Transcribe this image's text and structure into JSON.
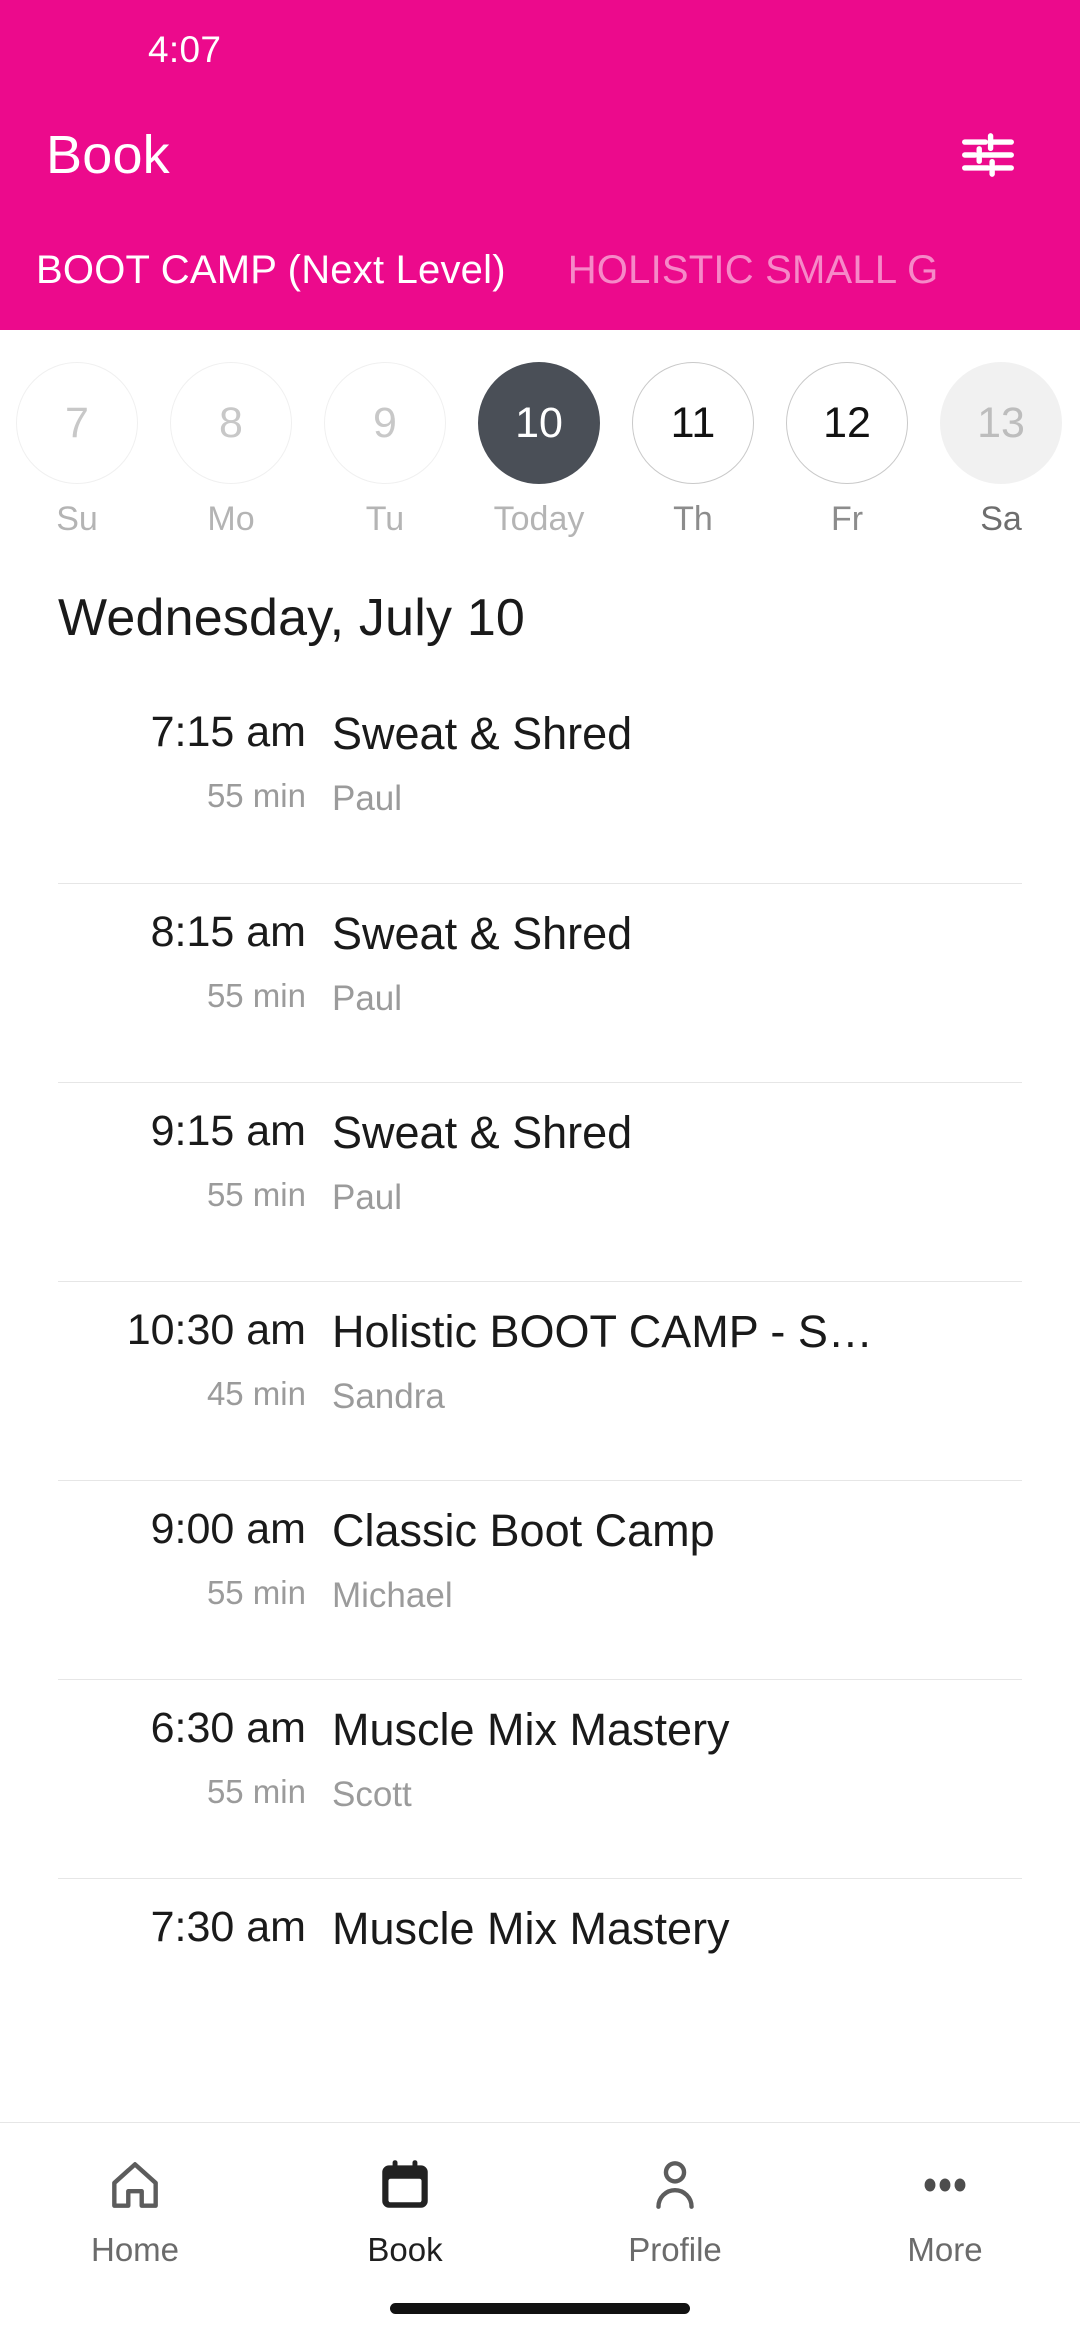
{
  "theme": {
    "brand_pink": "#ec0a8c",
    "selected_day": "#4a4f57",
    "text_primary": "#1a1a1a",
    "text_secondary": "#9b9b9b"
  },
  "status_bar": {
    "time": "4:07"
  },
  "header": {
    "title": "Book",
    "filter_icon": "tune-icon"
  },
  "tabs": [
    {
      "label": "BOOT CAMP (Next Level)",
      "active": true
    },
    {
      "label": "HOLISTIC SMALL G",
      "active": false
    }
  ],
  "date_strip": [
    {
      "day": "7",
      "weekday": "Su",
      "state": "past"
    },
    {
      "day": "8",
      "weekday": "Mo",
      "state": "past"
    },
    {
      "day": "9",
      "weekday": "Tu",
      "state": "past"
    },
    {
      "day": "10",
      "weekday": "Today",
      "state": "selected"
    },
    {
      "day": "11",
      "weekday": "Th",
      "state": "future"
    },
    {
      "day": "12",
      "weekday": "Fr",
      "state": "future"
    },
    {
      "day": "13",
      "weekday": "Sa",
      "state": "pressed"
    }
  ],
  "schedule": {
    "date_title": "Wednesday, July 10",
    "classes": [
      {
        "time": "7:15 am",
        "duration": "55 min",
        "name": "Sweat & Shred",
        "instructor": "Paul"
      },
      {
        "time": "8:15 am",
        "duration": "55 min",
        "name": "Sweat & Shred",
        "instructor": "Paul"
      },
      {
        "time": "9:15 am",
        "duration": "55 min",
        "name": "Sweat & Shred",
        "instructor": "Paul"
      },
      {
        "time": "10:30 am",
        "duration": "45 min",
        "name": "Holistic BOOT CAMP - S…",
        "instructor": "Sandra"
      },
      {
        "time": "9:00 am",
        "duration": "55 min",
        "name": "Classic Boot Camp",
        "instructor": "Michael"
      },
      {
        "time": "6:30 am",
        "duration": "55 min",
        "name": "Muscle Mix Mastery",
        "instructor": "Scott"
      },
      {
        "time": "7:30 am",
        "duration": "",
        "name": "Muscle Mix Mastery",
        "instructor": ""
      }
    ]
  },
  "bottom_nav": [
    {
      "label": "Home",
      "icon": "home-icon",
      "active": false
    },
    {
      "label": "Book",
      "icon": "calendar-icon",
      "active": true
    },
    {
      "label": "Profile",
      "icon": "person-icon",
      "active": false
    },
    {
      "label": "More",
      "icon": "dots-icon",
      "active": false
    }
  ]
}
